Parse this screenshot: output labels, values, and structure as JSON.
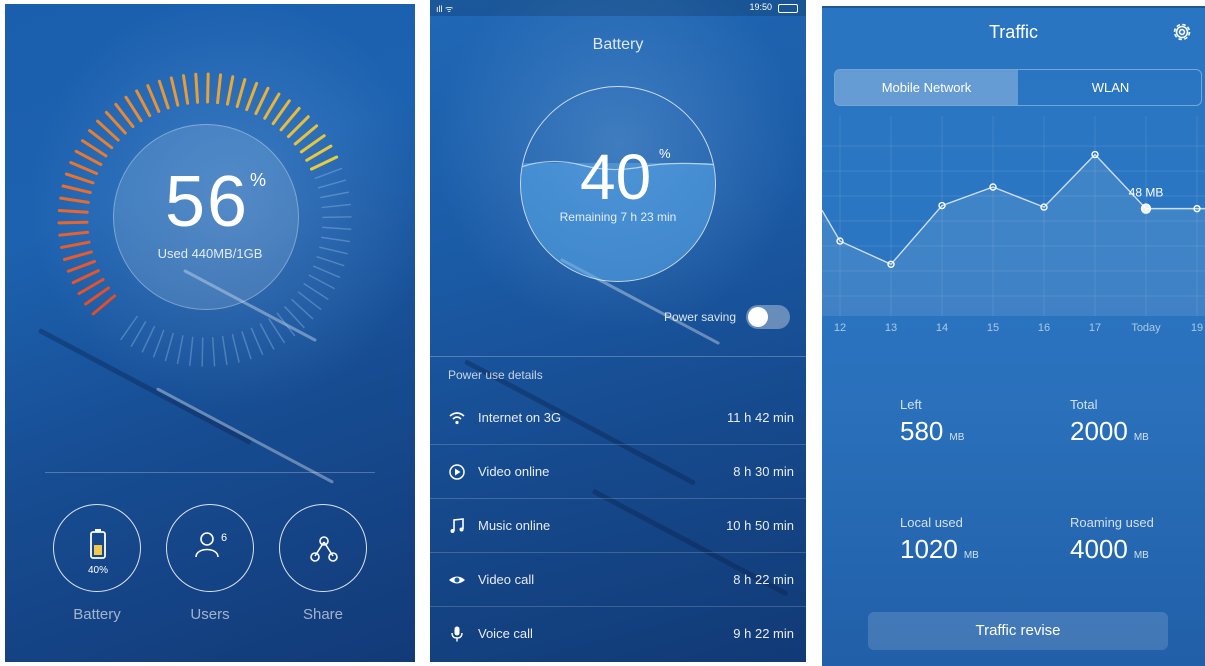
{
  "screen1": {
    "usage_percent": 56,
    "percent_sign": "%",
    "used_text": "Used 440MB/1GB",
    "gauge_fill_fraction": 0.56,
    "actions": [
      {
        "label": "Battery",
        "icon": "battery-icon",
        "badge": "40%"
      },
      {
        "label": "Users",
        "icon": "users-icon",
        "badge": "6"
      },
      {
        "label": "Share",
        "icon": "share-icon"
      }
    ]
  },
  "screen2": {
    "status_signal": "ıll ᯤ",
    "status_time": "19:50",
    "title": "Battery",
    "battery_percent": 40,
    "percent_sign": "%",
    "remaining": "Remaining 7 h 23 min",
    "power_saving_label": "Power saving",
    "power_saving_on": false,
    "details_title": "Power use details",
    "details": [
      {
        "icon": "wifi-icon",
        "label": "Internet on 3G",
        "value": "11 h 42 min"
      },
      {
        "icon": "play-icon",
        "label": "Video online",
        "value": "8 h 30 min"
      },
      {
        "icon": "music-icon",
        "label": "Music online",
        "value": "10 h 50 min"
      },
      {
        "icon": "eye-icon",
        "label": "Video call",
        "value": "8 h 22 min"
      },
      {
        "icon": "microphone-icon",
        "label": "Voice call",
        "value": "9 h 22 min"
      }
    ]
  },
  "screen3": {
    "title": "Traffic",
    "gear_icon": "gear-icon",
    "tabs": [
      {
        "label": "Mobile Network",
        "active": true
      },
      {
        "label": "WLAN",
        "active": false
      }
    ],
    "chart_data": {
      "type": "line",
      "x": [
        "12",
        "13",
        "14",
        "15",
        "16",
        "17",
        "Today",
        "19"
      ],
      "values": [
        42,
        27,
        65,
        77,
        64,
        98,
        63,
        63
      ],
      "highlight": {
        "x": "Today",
        "label": "48 MB"
      }
    },
    "stats": [
      {
        "label": "Left",
        "value": "580",
        "unit": "MB"
      },
      {
        "label": "Total",
        "value": "2000",
        "unit": "MB"
      },
      {
        "label": "Local used",
        "value": "1020",
        "unit": "MB"
      },
      {
        "label": "Roaming used",
        "value": "4000",
        "unit": "MB"
      }
    ],
    "revise_button": "Traffic revise"
  }
}
